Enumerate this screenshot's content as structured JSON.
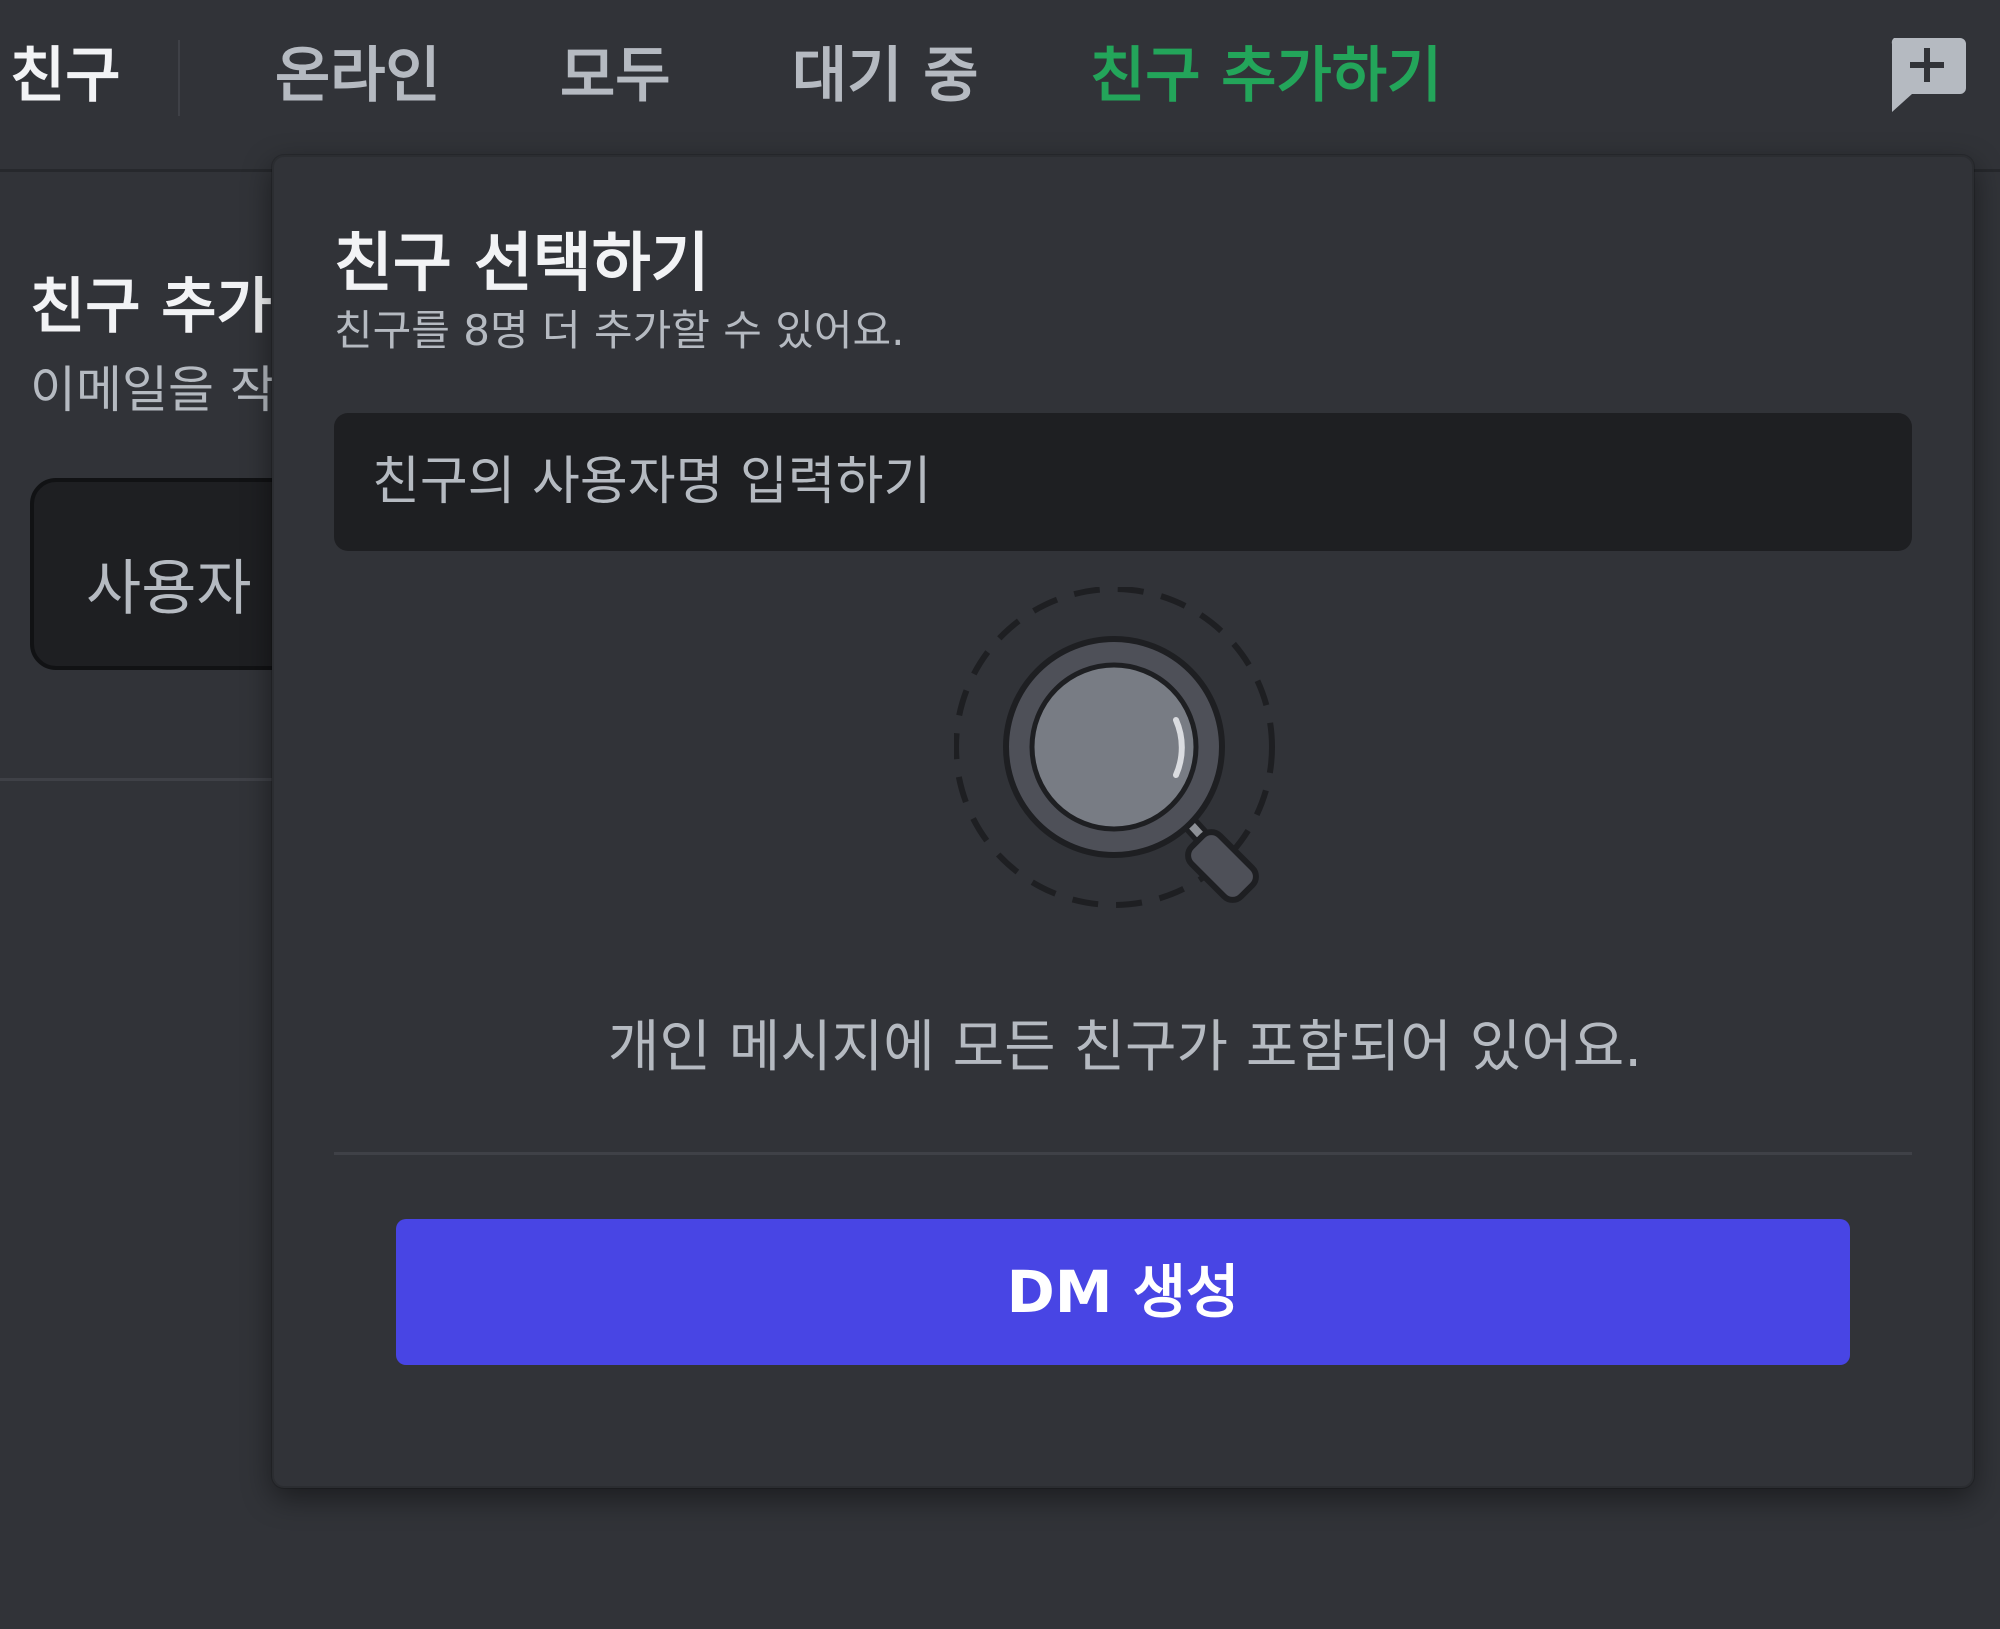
{
  "header": {
    "title": "친구",
    "tabs": [
      {
        "label": "온라인"
      },
      {
        "label": "모두"
      },
      {
        "label": "대기 중"
      },
      {
        "label": "친구 추가하기"
      }
    ],
    "accent_color": "#23a55a",
    "new_dm_icon": "new-group-dm-icon"
  },
  "background_page": {
    "title": "친구 추가하",
    "subtitle": "이메일을 작",
    "input_placeholder": "사용자"
  },
  "popout": {
    "title": "친구 선택하기",
    "subtitle": "친구를 8명 더 추가할 수 있어요.",
    "search_placeholder": "친구의 사용자명 입력하기",
    "illustration_icon": "magnifying-glass-icon",
    "empty_text": "개인 메시지에 모든 친구가 포함되어 있어요.",
    "button_label": "DM 생성",
    "button_color": "#4845e4"
  }
}
